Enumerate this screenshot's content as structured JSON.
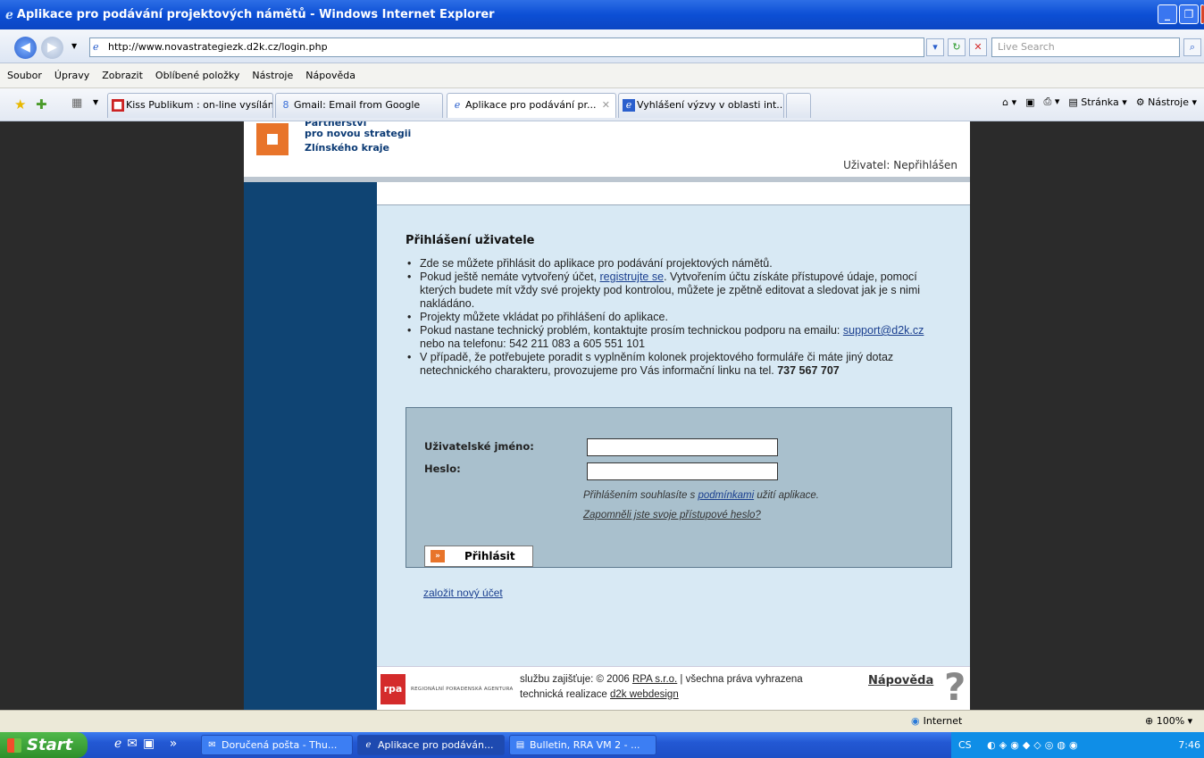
{
  "window": {
    "title": "Aplikace pro podávání projektových námětů - Windows Internet Explorer"
  },
  "address": {
    "url": "http://www.novastrategiezk.d2k.cz/login.php",
    "search_placeholder": "Live Search"
  },
  "menu": [
    "Soubor",
    "Úpravy",
    "Zobrazit",
    "Oblíbené položky",
    "Nástroje",
    "Nápověda"
  ],
  "tabs": [
    {
      "label": "Kiss Publikum : on-line vysílán...",
      "icon": "radio-icon"
    },
    {
      "label": "Gmail: Email from Google",
      "icon": "google-icon"
    },
    {
      "label": "Aplikace pro podávání pr...",
      "icon": "ie-icon",
      "active": true
    },
    {
      "label": "Vyhlášení výzvy v oblasti int...",
      "icon": "ie-icon"
    }
  ],
  "fav_tools": {
    "page": "Stránka",
    "tools": "Nástroje"
  },
  "site": {
    "logo_lines": [
      "Partnerství",
      "pro novou strategii",
      "Zlínského kraje"
    ],
    "user_status": "Uživatel: Nepřihlášen",
    "heading": "Přihlášení uživatele",
    "bullets": {
      "b1": "Zde se můžete přihlásit do aplikace pro podávání projektových námětů.",
      "b2_pre": "Pokud ještě nemáte vytvořený účet, ",
      "b2_link": "registrujte se",
      "b2_post": ". Vytvořením účtu získáte přístupové údaje, pomocí kterých budete mít vždy své projekty pod kontrolou, můžete je zpětně editovat a sledovat jak je s nimi nakládáno.",
      "b3": "Projekty můžete vkládat po přihlášení do aplikace.",
      "b4_pre": "Pokud nastane technický problém, kontaktujte prosím technickou podporu na emailu: ",
      "b4_link": "support@d2k.cz",
      "b4_post": " nebo na telefonu: 542 211 083 a 605 551 101",
      "b5_pre": "V případě, že potřebujete poradit s vyplněním kolonek projektového formuláře či máte jiný dotaz netechnického charakteru, provozujeme pro Vás informační linku na tel. ",
      "b5_phone": "737 567 707"
    },
    "form": {
      "username_label": "Uživatelské jméno:",
      "password_label": "Heslo:",
      "username_value": "",
      "password_value": "",
      "terms_pre": "Přihlášením souhlasíte s ",
      "terms_link": "podmínkami",
      "terms_post": " užití aplikace.",
      "forgot": "Zapomněli jste svoje přístupové heslo?",
      "login_button": "Přihlásit"
    },
    "new_account": "založit nový účet",
    "footer": {
      "agency": "REGIONÁLNÍ PORADENSKÁ AGENTURA",
      "rpa_mark": "rpa",
      "line1_pre": "službu zajišťuje: © 2006 ",
      "line1_link": "RPA s.r.o.",
      "line1_post": " | všechna práva vyhrazena",
      "line2_pre": "technická realizace ",
      "line2_link": "d2k webdesign",
      "help": "Nápověda"
    }
  },
  "status": {
    "zone": "Internet",
    "zoom": "100%"
  },
  "taskbar": {
    "start": "Start",
    "tasks": [
      "Doručená pošta - Thu...",
      "Aplikace pro podáván...",
      "Bulletin, RRA VM 2 - ..."
    ],
    "tray_lang": "CS",
    "clock": "7:46"
  },
  "colors": {
    "accent_orange": "#e8742a",
    "sidebar_blue": "#0f4473",
    "main_bg": "#d8e9f4",
    "form_bg": "#a9c0cd"
  }
}
